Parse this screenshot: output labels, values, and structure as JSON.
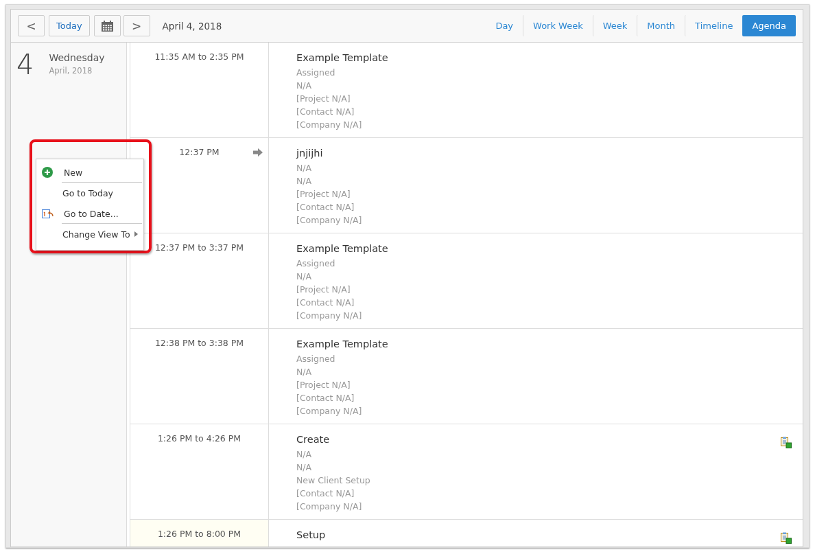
{
  "toolbar": {
    "prev": "<",
    "today": "Today",
    "next": ">",
    "date": "April 4, 2018"
  },
  "views": [
    {
      "label": "Day",
      "selected": false
    },
    {
      "label": "Work Week",
      "selected": false
    },
    {
      "label": "Week",
      "selected": false
    },
    {
      "label": "Month",
      "selected": false
    },
    {
      "label": "Timeline",
      "selected": false
    },
    {
      "label": "Agenda",
      "selected": true
    }
  ],
  "day": {
    "number": "4",
    "weekday": "Wednesday",
    "month": "April, 2018"
  },
  "appointments": [
    {
      "time": "11:35 AM to 2:35 PM",
      "current": false,
      "arrow": false,
      "attachment": false,
      "title": "Example Template",
      "details": [
        "Assigned",
        "N/A",
        "[Project N/A]",
        "[Contact N/A]",
        "[Company N/A]"
      ]
    },
    {
      "time": "12:37 PM",
      "current": false,
      "arrow": true,
      "attachment": false,
      "title": "jnjijhi",
      "details": [
        "N/A",
        "N/A",
        "[Project N/A]",
        "[Contact N/A]",
        "[Company N/A]"
      ]
    },
    {
      "time": "12:37 PM to 3:37 PM",
      "current": false,
      "arrow": false,
      "attachment": false,
      "title": "Example Template",
      "details": [
        "Assigned",
        "N/A",
        "[Project N/A]",
        "[Contact N/A]",
        "[Company N/A]"
      ]
    },
    {
      "time": "12:38 PM to 3:38 PM",
      "current": false,
      "arrow": false,
      "attachment": false,
      "title": "Example Template",
      "details": [
        "Assigned",
        "N/A",
        "[Project N/A]",
        "[Contact N/A]",
        "[Company N/A]"
      ]
    },
    {
      "time": "1:26 PM to 4:26 PM",
      "current": false,
      "arrow": false,
      "attachment": true,
      "title": "Create",
      "details": [
        "N/A",
        "N/A",
        "New Client Setup",
        "[Contact N/A]",
        "[Company N/A]"
      ]
    },
    {
      "time": "1:26 PM to 8:00 PM",
      "current": true,
      "arrow": false,
      "attachment": true,
      "title": "Setup"
    }
  ],
  "context_menu": {
    "highlighted": true,
    "items": [
      {
        "label": "New",
        "kind": "new"
      },
      {
        "label": "Go to Today",
        "kind": "plain"
      },
      {
        "label": "Go to Date...",
        "kind": "date"
      },
      {
        "label": "Change View To",
        "kind": "submenu"
      }
    ]
  }
}
